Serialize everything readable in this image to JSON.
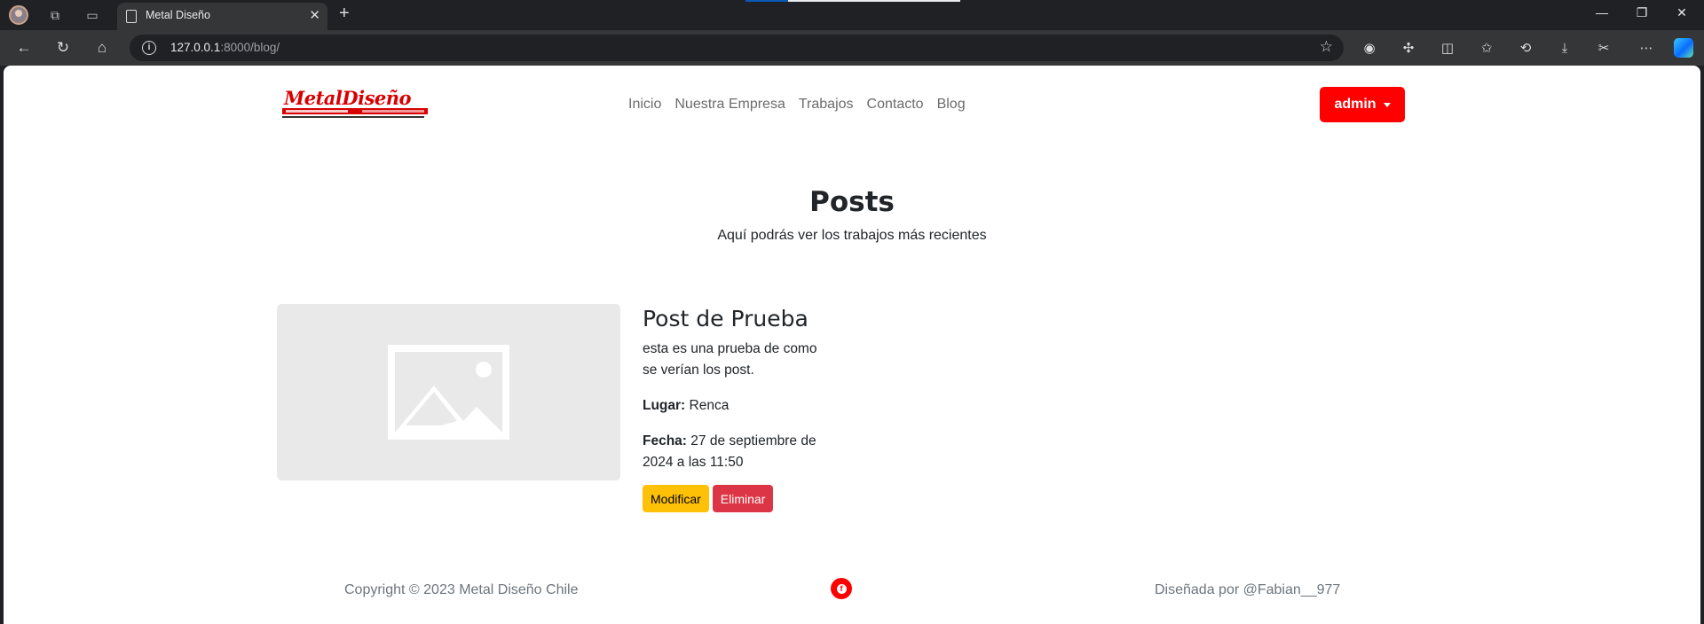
{
  "browser": {
    "tab_title": "Metal Diseño",
    "url_host": "127.0.0.1",
    "url_path": ":8000/blog/"
  },
  "site": {
    "logo_text": "MetalDiseño",
    "nav": [
      "Inicio",
      "Nuestra Empresa",
      "Trabajos",
      "Contacto",
      "Blog"
    ],
    "user_menu": "admin",
    "brand_color": "#ff0000"
  },
  "hero": {
    "title": "Posts",
    "subtitle": "Aquí podrás ver los trabajos más recientes"
  },
  "post": {
    "title": "Post de Prueba",
    "text": "esta es una prueba de como se verían los post.",
    "lugar_label": "Lugar:",
    "lugar_value": "Renca",
    "fecha_label": "Fecha:",
    "fecha_value": "27 de septiembre de 2024 a las 11:50",
    "edit_label": "Modificar",
    "delete_label": "Eliminar",
    "image_icon": "image-placeholder-icon"
  },
  "footer": {
    "copyright": "Copyright © 2023 Metal Diseño Chile",
    "social_icon": "facebook-icon",
    "credit": "Diseñada por @Fabian__977"
  }
}
